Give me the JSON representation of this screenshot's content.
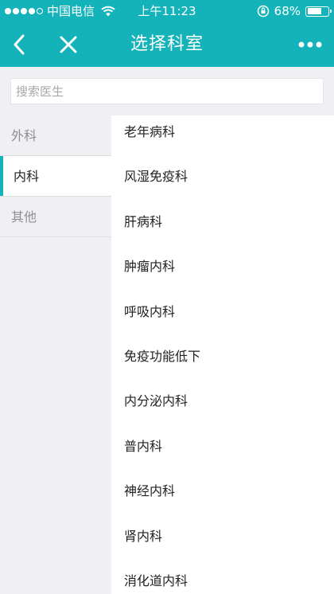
{
  "status_bar": {
    "signal": "●●●●○",
    "carrier": "中国电信",
    "time": "上午11:23",
    "battery": "68%",
    "battery_level": 0.68
  },
  "nav": {
    "title": "选择科室",
    "back_icon": "back-chevron-icon",
    "close_icon": "close-icon",
    "more_icon": "more-dots-icon"
  },
  "search": {
    "placeholder": "搜索医生",
    "value": ""
  },
  "sidebar": {
    "items": [
      {
        "label": "外科"
      },
      {
        "label": "内科"
      },
      {
        "label": "其他"
      }
    ],
    "active": "内科"
  },
  "departments": [
    "老年病科",
    "风湿免疫科",
    "肝病科",
    "肿瘤内科",
    "呼吸内科",
    "免疫功能低下",
    "内分泌内科",
    "普内科",
    "神经内科",
    "肾内科",
    "消化道内科"
  ],
  "colors": {
    "accent": "#14b3b9",
    "background": "#efeff4"
  }
}
